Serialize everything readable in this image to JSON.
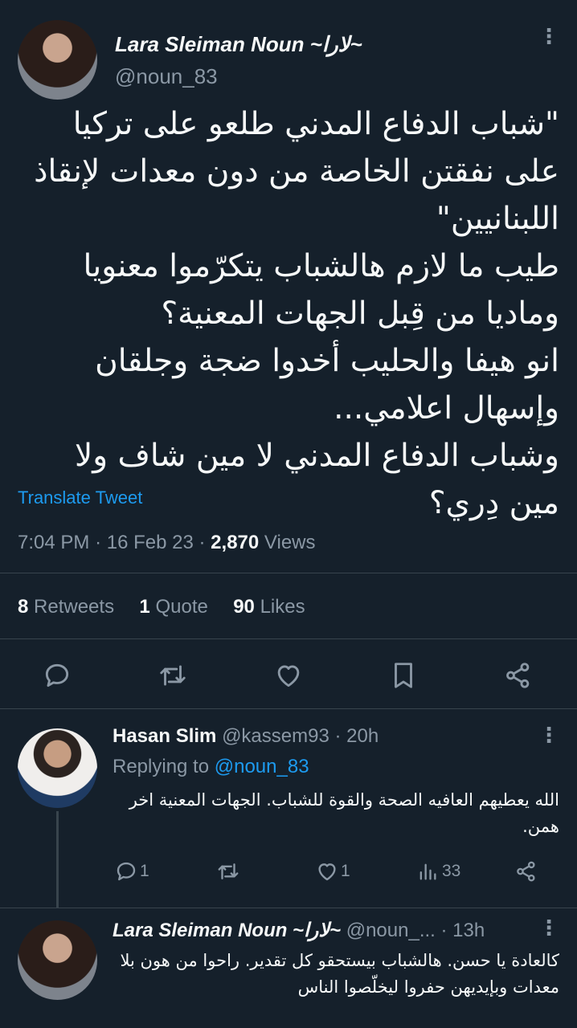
{
  "main_tweet": {
    "author_name": "Lara Sleiman Noun ~لارا~",
    "handle": "@noun_83",
    "text": "\"شباب الدفاع المدني طلعو على تركيا على نفقتن الخاصة من دون معدات لإنقاذ اللبنانيين\"\nطيب ما لازم هالشباب يتكرّموا معنويا وماديا من قِبل الجهات المعنية؟\nانو هيفا والحليب أخدوا ضجة وجلقان وإسهال اعلامي...\nوشباب الدفاع المدني لا مين شاف ولا مين دِري؟",
    "translate_label": "Translate Tweet",
    "time": "7:04 PM",
    "date": "16 Feb 23",
    "views_count": "2,870",
    "views_label": "Views",
    "retweets_count": "8",
    "retweets_label": "Retweets",
    "quotes_count": "1",
    "quotes_label": "Quote",
    "likes_count": "90",
    "likes_label": "Likes"
  },
  "replies": [
    {
      "author_name": "Hasan Slim",
      "handle": "@kassem93",
      "time": "· 20h",
      "replying_prefix": "Replying to",
      "replying_to": "@noun_83",
      "text": "الله يعطيهم العافيه الصحة والقوة للشباب. الجهات المعنية اخر همن.",
      "reply_count": "1",
      "retweet_count": "",
      "like_count": "1",
      "view_count": "33"
    },
    {
      "author_name": "Lara Sleiman Noun ~لارا~",
      "handle": "@noun_...",
      "time": "· 13h",
      "text": "كالعادة يا حسن. هالشباب بيستحقو كل تقدير. راحوا من هون بلا معدات وبإيديهن حفروا ليخلّصوا الناس"
    }
  ],
  "colors": {
    "background": "#15202b",
    "text": "#f7f9f9",
    "muted": "#8b98a5",
    "accent": "#1d9bf0",
    "divider": "#38444d"
  },
  "icons": [
    "reply-icon",
    "retweet-icon",
    "like-icon",
    "bookmark-icon",
    "share-icon",
    "views-icon",
    "more-icon"
  ]
}
